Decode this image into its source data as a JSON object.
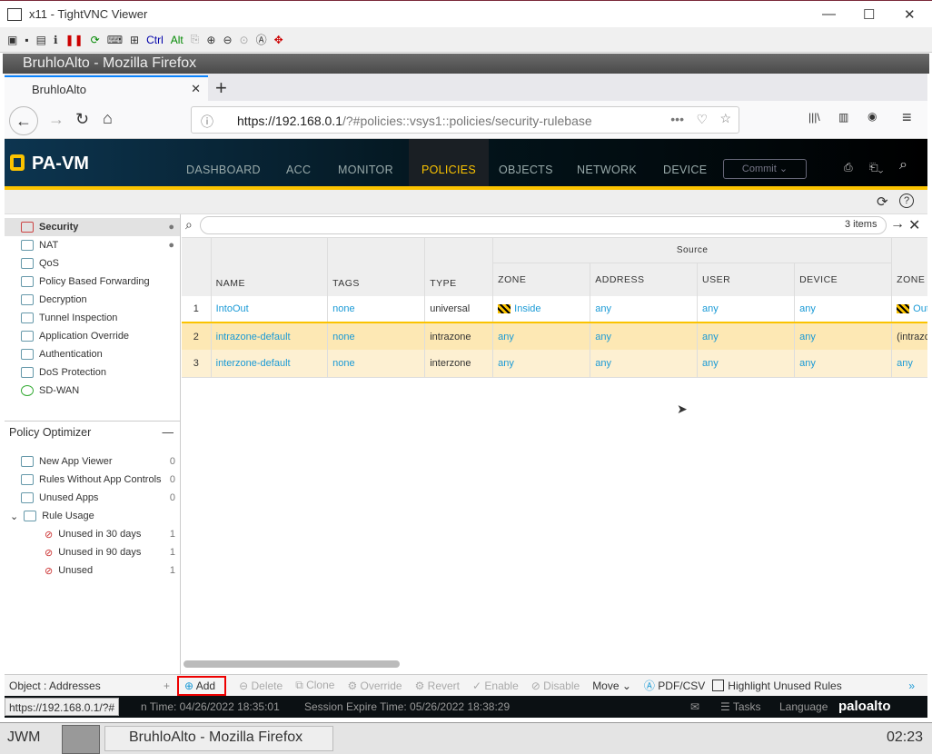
{
  "vnc": {
    "title": "x11 - TightVNC Viewer",
    "toolbar": {
      "ctrl": "Ctrl",
      "alt": "Alt"
    }
  },
  "firefox": {
    "title": "BruhloAlto - Mozilla Firefox",
    "tab": "BruhloAlto",
    "url_host": "https://192.168.0.1",
    "url_path": "/?#policies::vsys1::policies/security-rulebase"
  },
  "pan": {
    "logo": "PA-VM",
    "nav": [
      "DASHBOARD",
      "ACC",
      "MONITOR",
      "POLICIES",
      "OBJECTS",
      "NETWORK",
      "DEVICE"
    ],
    "active": "POLICIES",
    "commit": "Commit"
  },
  "sidebar": {
    "items": [
      "Security",
      "NAT",
      "QoS",
      "Policy Based Forwarding",
      "Decryption",
      "Tunnel Inspection",
      "Application Override",
      "Authentication",
      "DoS Protection",
      "SD-WAN"
    ],
    "selected": "Security"
  },
  "optimizer": {
    "title": "Policy Optimizer",
    "items": [
      {
        "label": "New App Viewer",
        "count": "0"
      },
      {
        "label": "Rules Without App Controls",
        "count": "0"
      },
      {
        "label": "Unused Apps",
        "count": "0"
      },
      {
        "label": "Rule Usage",
        "count": ""
      },
      {
        "label": "Unused in 30 days",
        "count": "1"
      },
      {
        "label": "Unused in 90 days",
        "count": "1"
      },
      {
        "label": "Unused",
        "count": "1"
      }
    ]
  },
  "object_panel": "Object : Addresses",
  "search": {
    "count": "3 items"
  },
  "table": {
    "group": "Source",
    "headers": [
      "NAME",
      "TAGS",
      "TYPE",
      "ZONE",
      "ADDRESS",
      "USER",
      "DEVICE",
      "ZONE"
    ],
    "rows": [
      {
        "n": "1",
        "name": "IntoOut",
        "tags": "none",
        "type": "universal",
        "szone": "Inside",
        "addr": "any",
        "user": "any",
        "device": "any",
        "dzone": "Outside"
      },
      {
        "n": "2",
        "name": "intrazone-default",
        "tags": "none",
        "type": "intrazone",
        "szone": "any",
        "addr": "any",
        "user": "any",
        "device": "any",
        "dzone": "(intrazone)"
      },
      {
        "n": "3",
        "name": "interzone-default",
        "tags": "none",
        "type": "interzone",
        "szone": "any",
        "addr": "any",
        "user": "any",
        "device": "any",
        "dzone": "any"
      }
    ]
  },
  "toolbar": {
    "add": "Add",
    "delete": "Delete",
    "clone": "Clone",
    "override": "Override",
    "revert": "Revert",
    "enable": "Enable",
    "disable": "Disable",
    "move": "Move",
    "pdf": "PDF/CSV",
    "highlight": "Highlight Unused Rules"
  },
  "status": {
    "hover_url": "https://192.168.0.1/?#",
    "login": "n Time: 04/26/2022 18:35:01",
    "expire": "Session Expire Time: 05/26/2022 18:38:29",
    "tasks": "Tasks",
    "language": "Language",
    "brand": "paloalto"
  },
  "taskbar": {
    "wm": "JWM",
    "task": "BruhloAlto - Mozilla Firefox",
    "clock": "02:23"
  }
}
